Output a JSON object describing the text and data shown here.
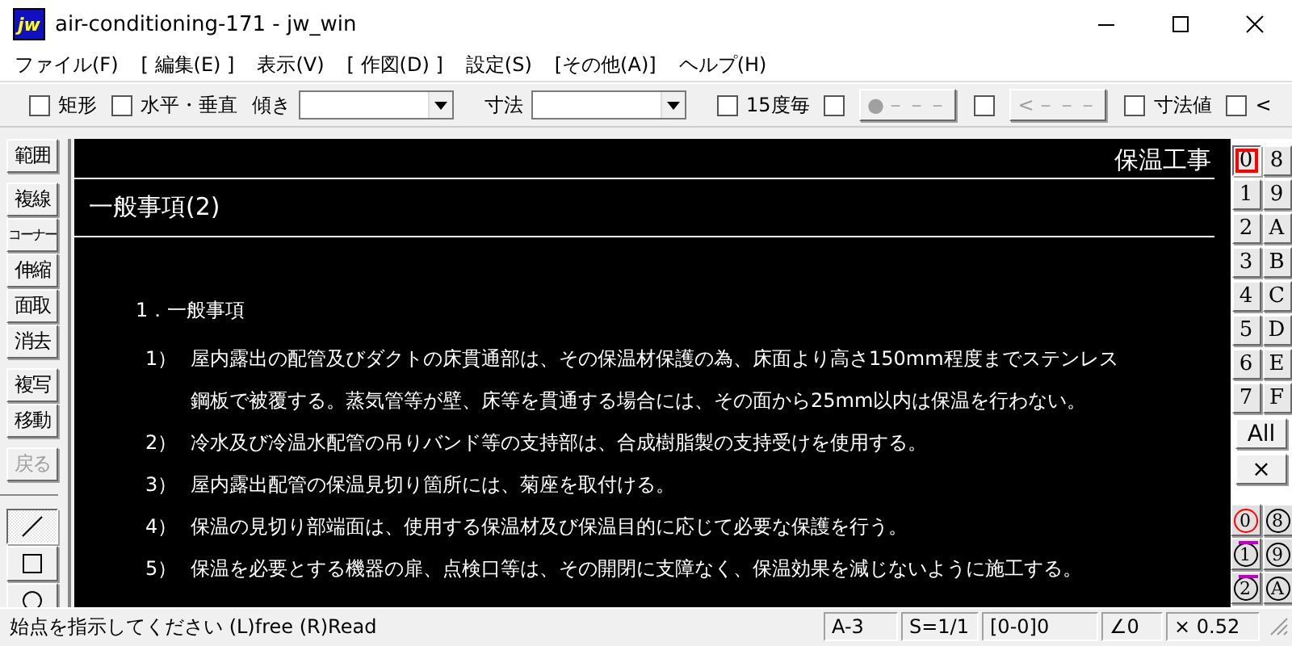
{
  "window": {
    "app_icon_text": "jw",
    "title": "air-conditioning-171 - jw_win"
  },
  "menu": [
    "ファイル(F)",
    "[ 編集(E) ]",
    "表示(V)",
    "[ 作図(D) ]",
    "設定(S)",
    "[その他(A)]",
    "ヘルプ(H)"
  ],
  "toolbar": [
    {
      "kind": "checkbox",
      "label": "矩形",
      "checked": false
    },
    {
      "kind": "checkbox",
      "label": "水平・垂直",
      "checked": false
    },
    {
      "kind": "label",
      "text": "傾き"
    },
    {
      "kind": "combo"
    },
    {
      "kind": "label",
      "text": "寸法"
    },
    {
      "kind": "combo"
    },
    {
      "kind": "checkbox",
      "label": "15度毎",
      "checked": false
    },
    {
      "kind": "checkbox",
      "checked": false
    },
    {
      "kind": "button",
      "label": "●－－－",
      "disabled": true
    },
    {
      "kind": "checkbox",
      "checked": false
    },
    {
      "kind": "button",
      "label": "<－－－",
      "disabled": true
    },
    {
      "kind": "checkbox",
      "label": "寸法値",
      "checked": false
    },
    {
      "kind": "checkbox",
      "label": "<",
      "checked": false
    }
  ],
  "tool_groups": [
    [
      {
        "label": "範囲",
        "disabled": false
      }
    ],
    [
      {
        "label": "複線",
        "disabled": false
      },
      {
        "label": "コーナー",
        "disabled": false
      },
      {
        "label": "伸縮",
        "disabled": false
      },
      {
        "label": "面取",
        "disabled": false
      },
      {
        "label": "消去",
        "disabled": false
      }
    ],
    [
      {
        "label": "複写",
        "disabled": false
      },
      {
        "label": "移動",
        "disabled": false
      }
    ],
    [
      {
        "label": "戻る",
        "disabled": true
      }
    ]
  ],
  "draw_tools": [
    {
      "kind": "line",
      "selected": true
    },
    {
      "kind": "rect",
      "selected": false
    },
    {
      "kind": "circle",
      "selected": false
    }
  ],
  "drawing": {
    "header": "保温工事",
    "title": "一般事項(2)",
    "section": "1．一般事項",
    "items": [
      {
        "number": "1）",
        "lines": [
          "屋内露出の配管及びダクトの床貫通部は、その保温材保護の為、床面より高さ150mm程度までステンレス",
          "鋼板で被覆する。蒸気管等が壁、床等を貫通する場合には、その面から25mm以内は保温を行わない。"
        ]
      },
      {
        "number": "2）",
        "lines": [
          "冷水及び冷温水配管の吊りバンド等の支持部は、合成樹脂製の支持受けを使用する。"
        ]
      },
      {
        "number": "3）",
        "lines": [
          "屋内露出配管の保温見切り箇所には、菊座を取付ける。"
        ]
      },
      {
        "number": "4）",
        "lines": [
          "保温の見切り部端面は、使用する保温材及び保温目的に応じて必要な保護を行う。"
        ]
      },
      {
        "number": "5）",
        "lines": [
          "保温を必要とする機器の扉、点検口等は、その開閉に支障なく、保温効果を減じないように施工する。"
        ]
      }
    ]
  },
  "layers": [
    {
      "label": "0",
      "selected": true
    },
    {
      "label": "8",
      "selected": false
    },
    {
      "label": "1",
      "selected": false
    },
    {
      "label": "9",
      "selected": false
    },
    {
      "label": "2",
      "selected": false
    },
    {
      "label": "A",
      "selected": false
    },
    {
      "label": "3",
      "selected": false
    },
    {
      "label": "B",
      "selected": false
    },
    {
      "label": "4",
      "selected": false
    },
    {
      "label": "C",
      "selected": false
    },
    {
      "label": "5",
      "selected": false
    },
    {
      "label": "D",
      "selected": false
    },
    {
      "label": "6",
      "selected": false
    },
    {
      "label": "E",
      "selected": false
    },
    {
      "label": "7",
      "selected": false
    },
    {
      "label": "F",
      "selected": false
    }
  ],
  "layer_all": "All",
  "layer_none": "×",
  "layer_groups": [
    {
      "label": "0",
      "selected": true,
      "in_use": false
    },
    {
      "label": "8",
      "selected": false,
      "in_use": false
    },
    {
      "label": "1",
      "selected": false,
      "in_use": true
    },
    {
      "label": "9",
      "selected": false,
      "in_use": false
    },
    {
      "label": "2",
      "selected": false,
      "in_use": true
    },
    {
      "label": "A",
      "selected": false,
      "in_use": false
    }
  ],
  "status_bar": {
    "message": "始点を指示してください (L)free (R)Read",
    "cells": [
      "A-3",
      "S=1/1",
      "[0-0]0",
      "∠0",
      "× 0.52"
    ]
  }
}
